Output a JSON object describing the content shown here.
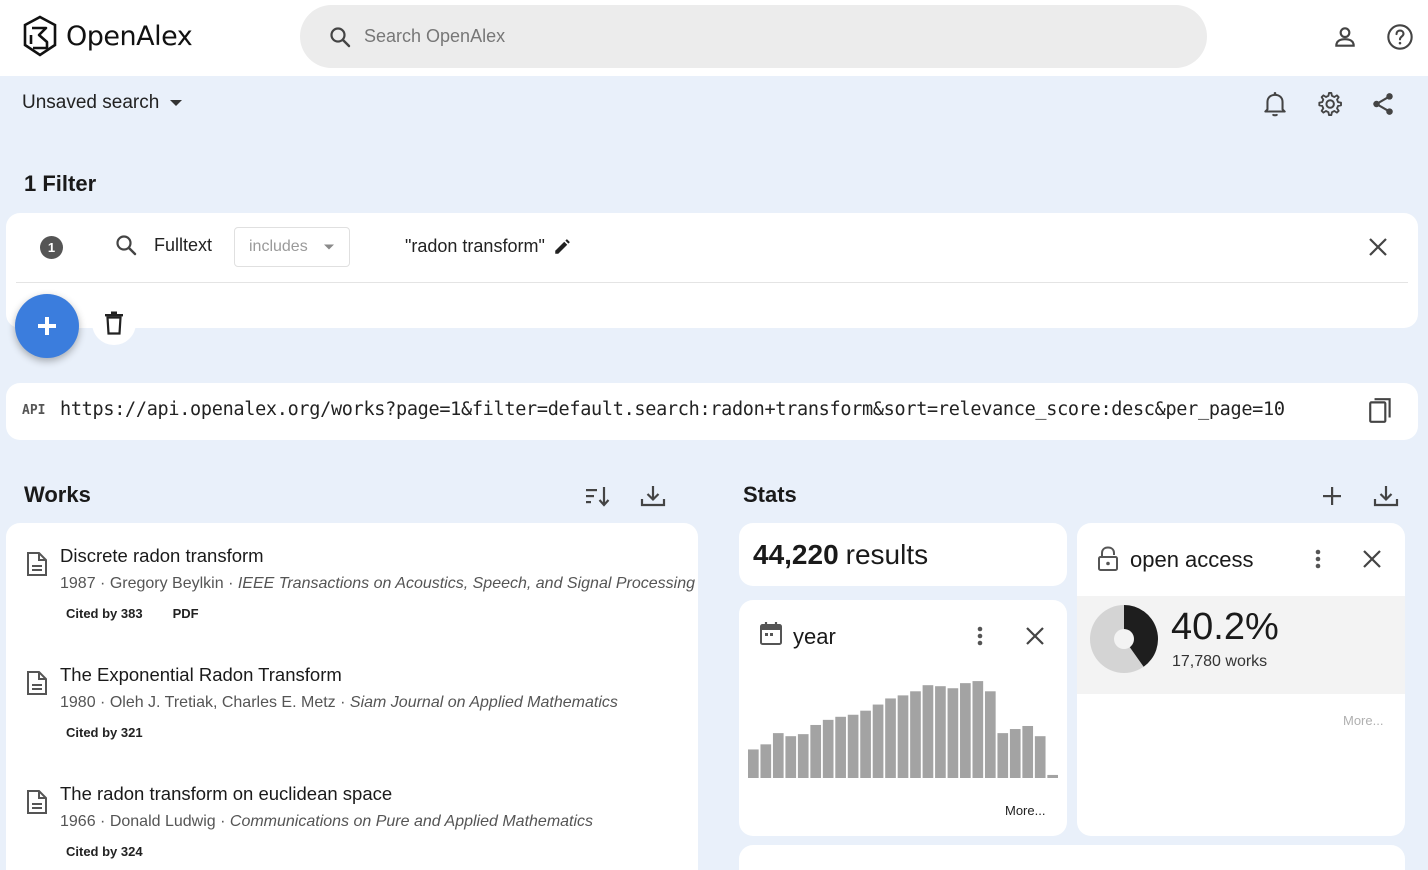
{
  "header": {
    "logo_text": "OpenAlex",
    "search_placeholder": "Search OpenAlex",
    "icons": [
      "account-icon",
      "help-icon"
    ]
  },
  "subheader": {
    "saved_search_label": "Unsaved search",
    "icons": [
      "bell-icon",
      "gear-icon",
      "share-icon"
    ]
  },
  "filters": {
    "heading": "1 Filter",
    "items": [
      {
        "number": "1",
        "field": "Fulltext",
        "operator": "includes",
        "value": "\"radon transform\""
      }
    ]
  },
  "api": {
    "label": "API",
    "url": "https://api.openalex.org/works?page=1&filter=default.search:radon+transform&sort=relevance_score:desc&per_page=10"
  },
  "works": {
    "title": "Works",
    "items": [
      {
        "title": "Discrete radon transform",
        "year": "1987",
        "authors": "Gregory Beylkin",
        "venue": "IEEE Transactions on Acoustics, Speech, and Signal Processing",
        "cited": "Cited by 383",
        "pdf": "PDF"
      },
      {
        "title": "The Exponential Radon Transform",
        "year": "1980",
        "authors": "Oleh J. Tretiak, Charles E. Metz",
        "venue": "Siam Journal on Applied Mathematics",
        "cited": "Cited by 321",
        "pdf": ""
      },
      {
        "title": "The radon transform on euclidean space",
        "year": "1966",
        "authors": "Donald Ludwig",
        "venue": "Communications on Pure and Applied Mathematics",
        "cited": "Cited by 324",
        "pdf": ""
      }
    ]
  },
  "stats": {
    "title": "Stats",
    "results_count": "44,220",
    "results_label": "results",
    "year_card": {
      "title": "year",
      "more": "More...",
      "bar_color": "#a3a3a3",
      "histogram_relative": [
        0.28,
        0.33,
        0.44,
        0.41,
        0.43,
        0.52,
        0.57,
        0.6,
        0.62,
        0.66,
        0.72,
        0.78,
        0.81,
        0.85,
        0.91,
        0.9,
        0.88,
        0.93,
        0.95,
        0.85,
        0.44,
        0.48,
        0.51,
        0.41,
        0.03
      ]
    },
    "open_access_card": {
      "title": "open access",
      "percent": "40.2%",
      "percent_value": 0.402,
      "works": "17,780 works",
      "more": "More..."
    }
  },
  "colors": {
    "accent": "#3b7ddd",
    "page_bg": "#e9f0fa",
    "pie_dark": "#1e1e1e",
    "pie_light": "#d4d4d4"
  }
}
